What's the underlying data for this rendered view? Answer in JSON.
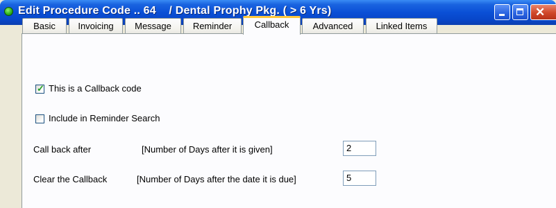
{
  "window": {
    "title": "Edit Procedure Code .. 64    / Dental Prophy Pkg. ( > 6 Yrs)",
    "status_icon": "green-circle-icon",
    "controls": {
      "minimize": "minimize-icon",
      "maximize": "maximize-icon",
      "close": "close-icon",
      "close_glyph": "✕"
    },
    "accent": "#0a4fd6"
  },
  "tabs": [
    {
      "label": "Basic",
      "active": false
    },
    {
      "label": "Invoicing",
      "active": false
    },
    {
      "label": "Message",
      "active": false
    },
    {
      "label": "Reminder",
      "active": false
    },
    {
      "label": "Callback",
      "active": true
    },
    {
      "label": "Advanced",
      "active": false
    },
    {
      "label": "Linked Items",
      "active": false
    }
  ],
  "callback": {
    "is_callback": {
      "label": "This is a Callback code",
      "checked": true
    },
    "include_reminder": {
      "label": "Include in Reminder Search",
      "checked": false
    },
    "call_back_after": {
      "label": "Call back after",
      "hint": "[Number of Days after it is given]",
      "value": "2"
    },
    "clear_callback": {
      "label": "Clear the Callback",
      "hint": "[Number of Days after the date it is due]",
      "value": "5"
    }
  }
}
